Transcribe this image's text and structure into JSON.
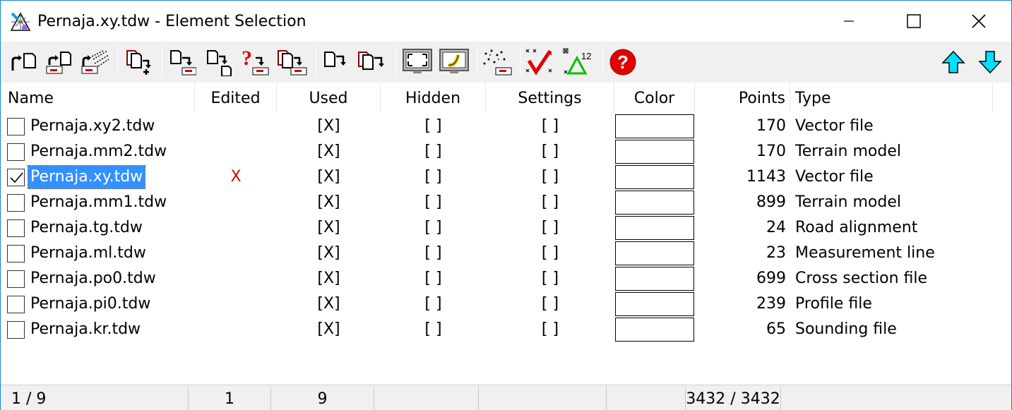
{
  "window": {
    "title": "Pernaja.xy.tdw - Element Selection"
  },
  "toolbar": {
    "buttons": [
      "open-file-icon",
      "open-file-list-icon",
      "open-multiple-icon",
      "add-file-icon",
      "move-file-icon",
      "move-file-down-icon",
      "query-file-icon",
      "replace-file-icon",
      "copy-file-icon",
      "copy-file-red-icon",
      "fit-view-icon",
      "display-icon",
      "points-icon",
      "check-icon",
      "triangle-numbering-icon",
      "help-icon",
      "move-up-icon",
      "move-down-icon"
    ]
  },
  "columns": {
    "name": "Name",
    "edited": "Edited",
    "used": "Used",
    "hidden": "Hidden",
    "settings": "Settings",
    "color": "Color",
    "points": "Points",
    "type": "Type"
  },
  "rows": [
    {
      "checked": false,
      "name": "Pernaja.xy2.tdw",
      "edited": "",
      "used": "[X]",
      "hidden": "[  ]",
      "settings": "[  ]",
      "points": "170",
      "type": "Vector file"
    },
    {
      "checked": false,
      "name": "Pernaja.mm2.tdw",
      "edited": "",
      "used": "[X]",
      "hidden": "[  ]",
      "settings": "[  ]",
      "points": "170",
      "type": "Terrain model"
    },
    {
      "checked": true,
      "name": "Pernaja.xy.tdw",
      "edited": "X",
      "used": "[X]",
      "hidden": "[  ]",
      "settings": "[  ]",
      "points": "1143",
      "type": "Vector file",
      "selected": true
    },
    {
      "checked": false,
      "name": "Pernaja.mm1.tdw",
      "edited": "",
      "used": "[X]",
      "hidden": "[  ]",
      "settings": "[  ]",
      "points": "899",
      "type": "Terrain model"
    },
    {
      "checked": false,
      "name": "Pernaja.tg.tdw",
      "edited": "",
      "used": "[X]",
      "hidden": "[  ]",
      "settings": "[  ]",
      "points": "24",
      "type": "Road alignment"
    },
    {
      "checked": false,
      "name": "Pernaja.ml.tdw",
      "edited": "",
      "used": "[X]",
      "hidden": "[  ]",
      "settings": "[  ]",
      "points": "23",
      "type": "Measurement line"
    },
    {
      "checked": false,
      "name": "Pernaja.po0.tdw",
      "edited": "",
      "used": "[X]",
      "hidden": "[  ]",
      "settings": "[  ]",
      "points": "699",
      "type": "Cross section file"
    },
    {
      "checked": false,
      "name": "Pernaja.pi0.tdw",
      "edited": "",
      "used": "[X]",
      "hidden": "[  ]",
      "settings": "[  ]",
      "points": "239",
      "type": "Profile file"
    },
    {
      "checked": false,
      "name": "Pernaja.kr.tdw",
      "edited": "",
      "used": "[X]",
      "hidden": "[  ]",
      "settings": "[  ]",
      "points": "65",
      "type": "Sounding file"
    }
  ],
  "status": {
    "position": "1 / 9",
    "edited_count": "1",
    "used_count": "9",
    "points_total": "3432 / 3432"
  },
  "colors": {
    "selection": "#3390ff",
    "edited_mark": "#e00000",
    "arrow": "#00e0ff",
    "help": "#e00000"
  }
}
